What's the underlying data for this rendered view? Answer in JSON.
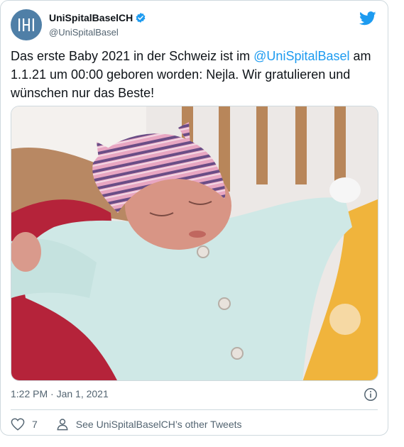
{
  "author": {
    "display_name": "UniSpitalBaselCH",
    "handle": "@UniSpitalBasel"
  },
  "tweet": {
    "text_before": "Das erste Baby 2021 in der Schweiz ist im ",
    "mention": "@UniSpitalBasel",
    "text_after": " am 1.1.21 um 00:00 geboren worden: Nejla. Wir gratulieren und wünschen nur das Beste!",
    "timestamp": "1:22 PM · Jan 1, 2021"
  },
  "actions": {
    "like_count": "7",
    "other_tweets_label": "See UniSpitalBaselCH’s other Tweets"
  },
  "colors": {
    "link": "#1d9bf0",
    "muted": "#536471",
    "avatar": "#4f7fa7"
  },
  "icons": [
    "unispital-logo-icon",
    "verified-badge-icon",
    "twitter-bird-icon",
    "info-icon",
    "heart-icon",
    "person-icon"
  ]
}
